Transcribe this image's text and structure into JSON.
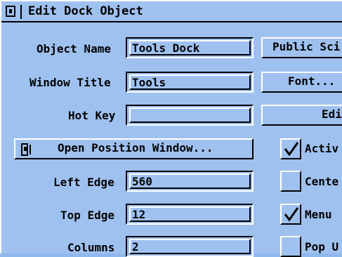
{
  "window": {
    "title": "Edit Dock Object"
  },
  "form": {
    "object_name_label": "Object Name",
    "object_name_value": "Tools Dock",
    "window_title_label": "Window Title",
    "window_title_value": "Tools",
    "hot_key_label": "Hot Key",
    "hot_key_value": "",
    "left_edge_label": "Left Edge",
    "left_edge_value": "560",
    "top_edge_label": "Top Edge",
    "top_edge_value": "12",
    "columns_label": "Columns",
    "columns_value": "2"
  },
  "buttons": {
    "open_position": "Open Position Window...",
    "public_screen": "Public Sci",
    "font": "Font...",
    "edit": "Edi"
  },
  "checkboxes": [
    {
      "label": "Activ",
      "checked": true
    },
    {
      "label": "Cente",
      "checked": false
    },
    {
      "label": "Menu",
      "checked": true
    },
    {
      "label": "Pop U",
      "checked": false
    }
  ],
  "colors": {
    "background": "#9fc1f0",
    "shine": "#ffffff",
    "shadow": "#000000"
  }
}
